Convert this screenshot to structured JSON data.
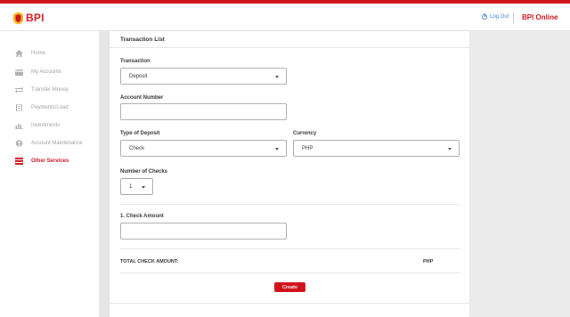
{
  "header": {
    "logo_text": "BPI",
    "logout_label": "Log Out",
    "brand": "BPI Online"
  },
  "sidebar": {
    "items": [
      {
        "label": "Home",
        "icon": "home-icon"
      },
      {
        "label": "My Accounts",
        "icon": "wallet-icon"
      },
      {
        "label": "Transfer Money",
        "icon": "transfer-icon"
      },
      {
        "label": "Payments/Load",
        "icon": "bill-icon"
      },
      {
        "label": "Investments",
        "icon": "bar-chart-icon"
      },
      {
        "label": "Account Maintenance",
        "icon": "user-icon"
      },
      {
        "label": "Other Services",
        "icon": "list-icon",
        "active": true
      }
    ]
  },
  "form": {
    "title": "Transaction List",
    "transaction_label": "Transaction",
    "transaction_value": "Deposit",
    "account_number_label": "Account Number",
    "account_number_value": "",
    "type_label": "Type of Deposit",
    "type_value": "Check",
    "currency_label": "Currency",
    "currency_value": "PHP",
    "num_checks_label": "Number of Checks",
    "num_checks_value": "1",
    "check_amount_label": "1. Check Amount",
    "check_amount_value": "",
    "total_label": "TOTAL CHECK AMOUNT:",
    "total_currency": "PHP",
    "create_label": "Create"
  },
  "colors": {
    "accent": "#d0121b",
    "link": "#3a7fd5",
    "background": "#ececec"
  }
}
